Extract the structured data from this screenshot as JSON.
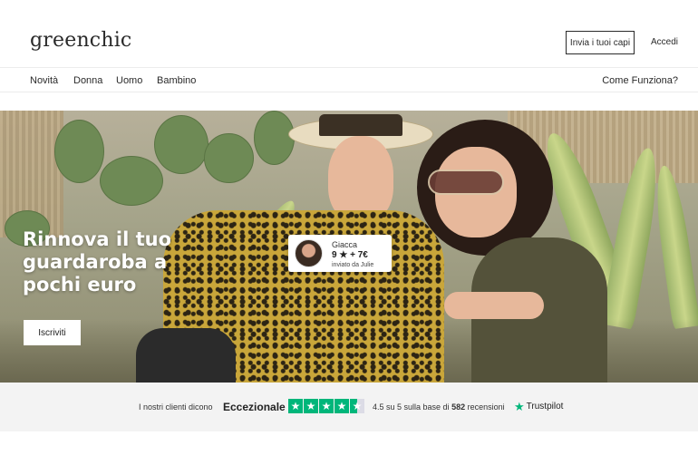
{
  "header": {
    "logo": "greenchic",
    "send_items_button": "Invia i tuoi capi",
    "login_link": "Accedi"
  },
  "nav": {
    "items": [
      "Novità",
      "Donna",
      "Uomo",
      "Bambino"
    ],
    "how_it_works": "Come Funziona?"
  },
  "hero": {
    "title": "Rinnova il tuo guardaroba a pochi euro",
    "subscribe_button": "Iscriviti",
    "card": {
      "item": "Giacca",
      "price": "9 ★ + 7€",
      "sender": "inviato da Julie"
    }
  },
  "trust": {
    "lead": "I nostri clienti dicono",
    "rating_word": "Eccezionale",
    "stars": 4.5,
    "score_prefix": "4.5 su 5 sulla base di",
    "review_count": "582",
    "score_suffix": "recensioni",
    "brand": "Trustpilot"
  },
  "colors": {
    "trustpilot_green": "#00b67a",
    "text_dark": "#2a2a2a"
  }
}
